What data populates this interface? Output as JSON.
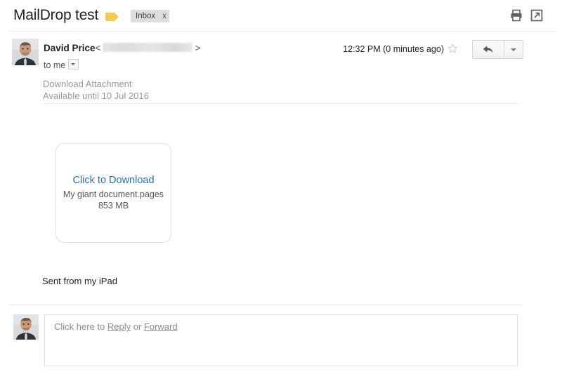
{
  "header": {
    "subject": "MailDrop test",
    "label_icon": "label-tag-icon",
    "label_chip": "Inbox",
    "label_chip_close": "x",
    "print_icon": "print-icon",
    "popout_icon": "open-in-new-window-icon"
  },
  "message": {
    "sender_name": "David Price",
    "angle_open": "<",
    "angle_close": ">",
    "email_redacted": "",
    "recipient": "to me",
    "recipient_caret_icon": "chevron-down-icon",
    "timestamp": "12:32 PM (0 minutes ago)",
    "star_icon": "star-icon",
    "reply_icon": "reply-arrow-icon",
    "reply_more_icon": "chevron-down-icon",
    "avatar_icon": "sender-avatar-photo"
  },
  "body": {
    "attachment_heading": "Download Attachment",
    "attachment_availability": "Available until 10 Jul 2016",
    "card": {
      "link_label": "Click to Download",
      "filename": "My giant document.pages",
      "filesize": "853 MB"
    },
    "signature": "Sent from my iPad"
  },
  "reply": {
    "prefix": "Click here to ",
    "reply_link": "Reply",
    "separator": " or ",
    "forward_link": "Forward",
    "avatar_icon": "user-avatar-photo"
  },
  "colors": {
    "link_blue": "#2a6ebb",
    "label_yellow": "#f5cb54",
    "muted_text": "#999999",
    "divider": "#ebebeb"
  }
}
